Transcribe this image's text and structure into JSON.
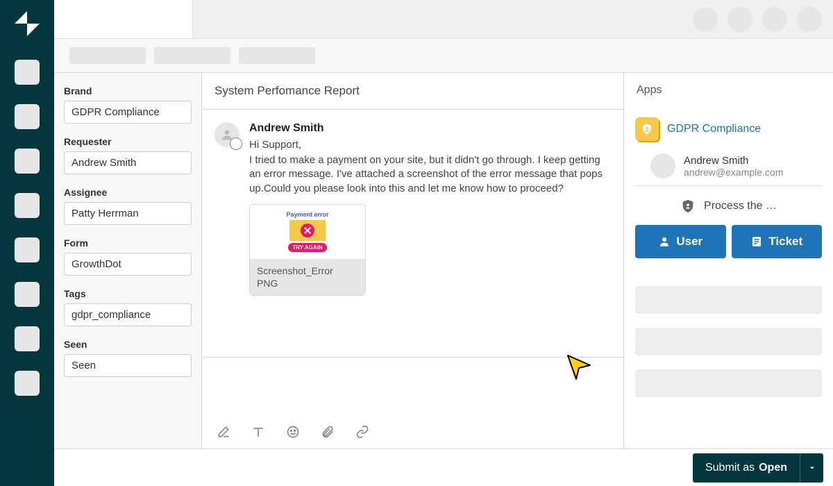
{
  "sidebar": {
    "brand_label": "Brand",
    "brand_value": "GDPR Compliance",
    "requester_label": "Requester",
    "requester_value": "Andrew Smith",
    "assignee_label": "Assignee",
    "assignee_value": "Patty Herrman",
    "form_label": "Form",
    "form_value": "GrowthDot",
    "tags_label": "Tags",
    "tags_value": "gdpr_compliance",
    "seen_label": "Seen",
    "seen_value": "Seen"
  },
  "ticket": {
    "title": "System Perfomance Report",
    "sender_name": "Andrew Smith",
    "greeting": "Hi Support,",
    "body": "I tried to make a payment on your site, but it didn't go through. I keep getting an error message. I've attached a screenshot of the error message that pops up.Could you please look into this and let me know how to proceed?",
    "attachment": {
      "preview_title": "Payment error",
      "preview_button": "TRY AGAIN",
      "filename": "Screenshot_Error",
      "type": "PNG"
    }
  },
  "apps": {
    "header": "Apps",
    "app_name": "GDPR Compliance",
    "user_name": "Andrew Smith",
    "user_email": "andrew@example.com",
    "process_text": "Process the …",
    "user_button": "User",
    "ticket_button": "Ticket"
  },
  "footer": {
    "submit_prefix": "Submit as ",
    "submit_status": "Open"
  }
}
